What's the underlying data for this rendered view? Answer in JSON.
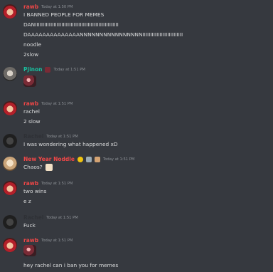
{
  "messages": [
    {
      "user": "rawb",
      "user_color": "#f04747",
      "time": "Today at 1:50 PM",
      "lines": [
        "I BANNED PEOPLE FOR MEMES",
        "DANIIIIIIIIIIIIIIIIIIIIIIIIIIIIIIIIIIIIIIIIIIIIIIIIIIIIII",
        "DAAAAAAAAAAAAAANNNNNNNNNNNNNNNNIIIIIIIIIIIIIIIIIIIIIIIIII",
        "noodle",
        "2slow"
      ]
    },
    {
      "user": "Pjinon",
      "user_color": "#1abc9c",
      "time": "Today at 1:51 PM",
      "lines": []
    },
    {
      "user": "rawb",
      "user_color": "#f04747",
      "time": "Today at 1:51 PM",
      "lines": [
        "rachel",
        "2 slow"
      ]
    },
    {
      "user": "Rachel",
      "user_color": "#2f3136",
      "time": "Today at 1:51 PM",
      "lines": [
        "I was wondering what happened xD"
      ]
    },
    {
      "user": "New Year Noddle",
      "user_color": "#f04747",
      "time": "Today at 1:51 PM",
      "lines": [
        "Chaos?"
      ]
    },
    {
      "user": "rawb",
      "user_color": "#f04747",
      "time": "Today at 1:51 PM",
      "lines": [
        "two wins",
        "e z"
      ]
    },
    {
      "user": "Rachel",
      "user_color": "#2f3136",
      "time": "Today at 1:51 PM",
      "lines": [
        "Fuck"
      ]
    },
    {
      "user": "rawb",
      "user_color": "#f04747",
      "time": "Today at 1:51 PM",
      "lines": [
        "hey rachel can i ban you for memes"
      ]
    }
  ]
}
